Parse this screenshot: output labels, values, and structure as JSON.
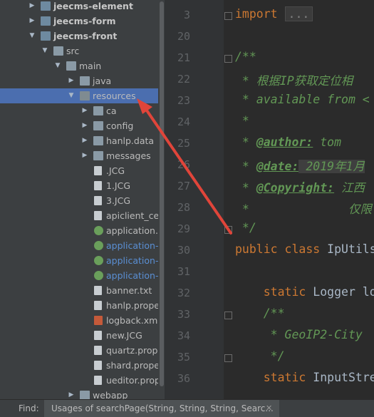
{
  "tree": {
    "items": [
      {
        "label": "jeecms-element",
        "style": "bold",
        "icon": "module-folder-icon"
      },
      {
        "label": "jeecms-form",
        "style": "bold",
        "icon": "module-folder-icon"
      },
      {
        "label": "jeecms-front",
        "style": "bold",
        "icon": "module-folder-icon",
        "expanded": true
      },
      {
        "label": "src",
        "icon": "folder-icon",
        "expanded": true
      },
      {
        "label": "main",
        "icon": "folder-icon",
        "expanded": true
      },
      {
        "label": "java",
        "icon": "source-folder-icon"
      },
      {
        "label": "resources",
        "icon": "resources-folder-icon",
        "expanded": true,
        "selected": true
      },
      {
        "label": "ca",
        "icon": "folder-icon"
      },
      {
        "label": "config",
        "icon": "folder-icon"
      },
      {
        "label": "hanlp.data",
        "icon": "folder-icon"
      },
      {
        "label": "messages",
        "icon": "folder-icon"
      },
      {
        "label": ".JCG",
        "icon": "file-icon"
      },
      {
        "label": "1.JCG",
        "icon": "file-icon"
      },
      {
        "label": "3.JCG",
        "icon": "file-icon"
      },
      {
        "label": "apiclient_cert.p",
        "icon": "file-icon"
      },
      {
        "label": "application.pro",
        "icon": "spring-config-icon"
      },
      {
        "label": "application-be",
        "icon": "spring-config-icon",
        "style": "blue"
      },
      {
        "label": "application-de",
        "icon": "spring-config-icon",
        "style": "blue"
      },
      {
        "label": "application-pr",
        "icon": "spring-config-icon",
        "style": "blue"
      },
      {
        "label": "banner.txt",
        "icon": "text-file-icon"
      },
      {
        "label": "hanlp.properti",
        "icon": "properties-file-icon"
      },
      {
        "label": "logback.xml",
        "icon": "xml-file-icon"
      },
      {
        "label": "new.JCG",
        "icon": "file-icon"
      },
      {
        "label": "quartz.propert",
        "icon": "properties-file-icon"
      },
      {
        "label": "shard.properti",
        "icon": "properties-file-icon"
      },
      {
        "label": "ueditor.proper",
        "icon": "properties-file-icon"
      },
      {
        "label": "webapp",
        "icon": "folder-icon"
      }
    ]
  },
  "editor": {
    "lines": [
      {
        "num": "3",
        "html_kind": "import",
        "text": "import ..."
      },
      {
        "num": "20",
        "text": ""
      },
      {
        "num": "21",
        "text": "/**"
      },
      {
        "num": "22",
        "text": " * 根据IP获取定位相"
      },
      {
        "num": "23",
        "text": " * available from <"
      },
      {
        "num": "24",
        "text": " *"
      },
      {
        "num": "25",
        "tag": "@author:",
        "rest": " tom"
      },
      {
        "num": "26",
        "tag": "@date:",
        "rest": " 2019年1月"
      },
      {
        "num": "27",
        "tag": "@Copyright:",
        "rest": " 江西"
      },
      {
        "num": "28",
        "text": " *              仅限"
      },
      {
        "num": "29",
        "text": " */"
      },
      {
        "num": "30",
        "text": "public class IpUtils"
      },
      {
        "num": "31",
        "text": ""
      },
      {
        "num": "32",
        "text": "    static Logger lo"
      },
      {
        "num": "33",
        "text": "    /**"
      },
      {
        "num": "34",
        "text": "     * GeoIP2-City "
      },
      {
        "num": "35",
        "text": "     */"
      },
      {
        "num": "36",
        "text": "    static InputStre"
      }
    ]
  },
  "statusbar": {
    "find_label": "Find:",
    "tab_text": "Usages of searchPage(String, String, String, Searc...",
    "close_glyph": "✕"
  },
  "colors": {
    "selection": "#4b6eaf",
    "arrow": "#e0453a"
  }
}
